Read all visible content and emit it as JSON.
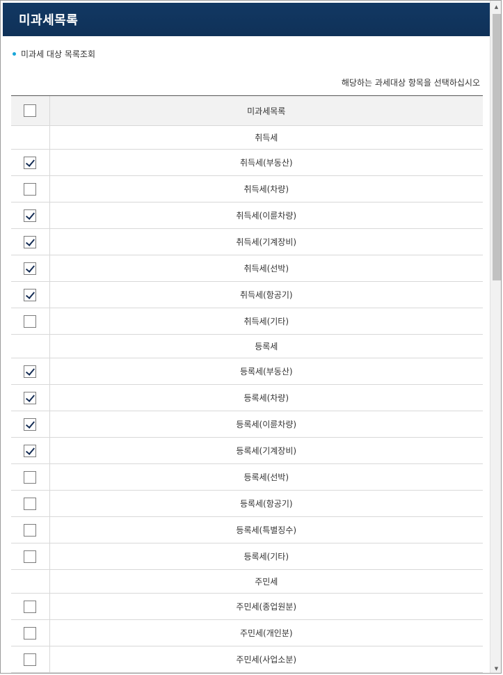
{
  "window": {
    "title": "미과세목록"
  },
  "section": {
    "subtitle": "미과세 대상 목록조회",
    "instruction": "해당하는 과세대상 항목을 선택하십시오"
  },
  "table": {
    "header": "미과세목록",
    "header_checked": false,
    "rows": [
      {
        "type": "group",
        "label": "취득세"
      },
      {
        "type": "item",
        "label": "취득세(부동산)",
        "checked": true
      },
      {
        "type": "item",
        "label": "취득세(차량)",
        "checked": false
      },
      {
        "type": "item",
        "label": "취득세(이륜차량)",
        "checked": true
      },
      {
        "type": "item",
        "label": "취득세(기계장비)",
        "checked": true
      },
      {
        "type": "item",
        "label": "취득세(선박)",
        "checked": true
      },
      {
        "type": "item",
        "label": "취득세(항공기)",
        "checked": true
      },
      {
        "type": "item",
        "label": "취득세(기타)",
        "checked": false
      },
      {
        "type": "group",
        "label": "등록세"
      },
      {
        "type": "item",
        "label": "등록세(부동산)",
        "checked": true
      },
      {
        "type": "item",
        "label": "등록세(차량)",
        "checked": true
      },
      {
        "type": "item",
        "label": "등록세(이륜차량)",
        "checked": true
      },
      {
        "type": "item",
        "label": "등록세(기계장비)",
        "checked": true
      },
      {
        "type": "item",
        "label": "등록세(선박)",
        "checked": false
      },
      {
        "type": "item",
        "label": "등록세(항공기)",
        "checked": false
      },
      {
        "type": "item",
        "label": "등록세(특별징수)",
        "checked": false
      },
      {
        "type": "item",
        "label": "등록세(기타)",
        "checked": false
      },
      {
        "type": "group",
        "label": "주민세"
      },
      {
        "type": "item",
        "label": "주민세(종업원분)",
        "checked": false
      },
      {
        "type": "item",
        "label": "주민세(개인분)",
        "checked": false
      },
      {
        "type": "item",
        "label": "주민세(사업소분)",
        "checked": false
      }
    ]
  },
  "scrollbar": {
    "up_icon": "triangle-up-icon",
    "down_icon": "triangle-down-icon"
  },
  "colors": {
    "title_bar": "#123863",
    "bullet": "#19a6d8",
    "check": "#152d55",
    "header_bg": "#f2f2f2"
  }
}
